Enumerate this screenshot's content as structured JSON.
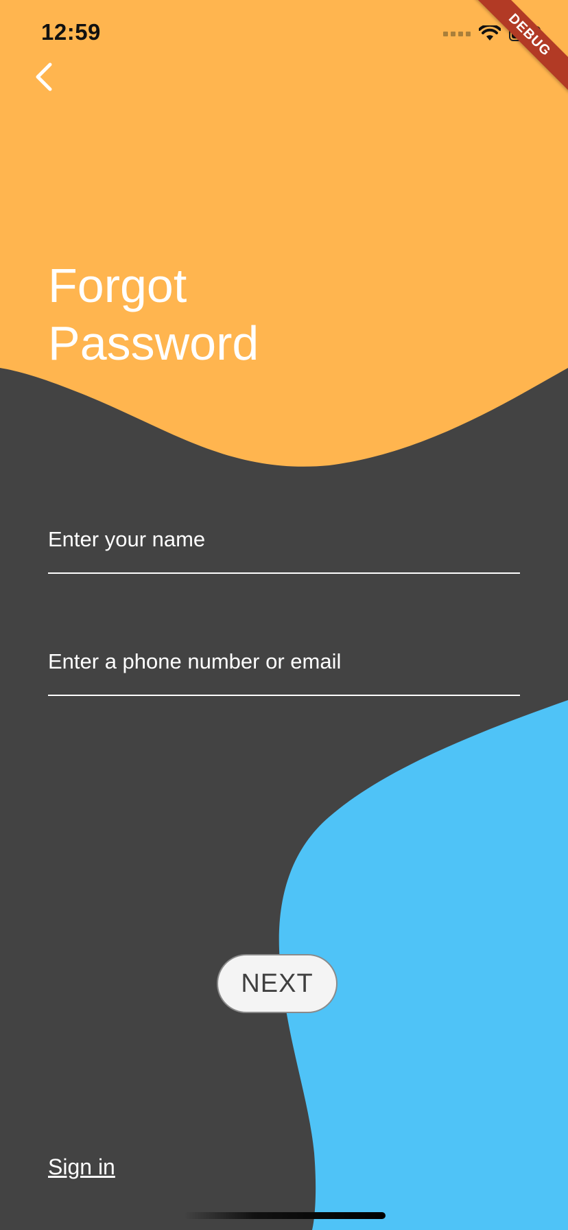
{
  "status_bar": {
    "time": "12:59",
    "debug_banner": "DEBUG"
  },
  "colors": {
    "top_blob": "#FFB54F",
    "bottom_blob": "#4FC3F7",
    "background": "#434343"
  },
  "header": {
    "back_icon": "chevron-left-icon",
    "title": "Forgot Password"
  },
  "form": {
    "name_field": {
      "placeholder": "Enter your name",
      "value": ""
    },
    "contact_field": {
      "placeholder": "Enter a phone number or email",
      "value": ""
    },
    "next_label": "NEXT"
  },
  "footer": {
    "sign_in_label": "Sign in"
  }
}
